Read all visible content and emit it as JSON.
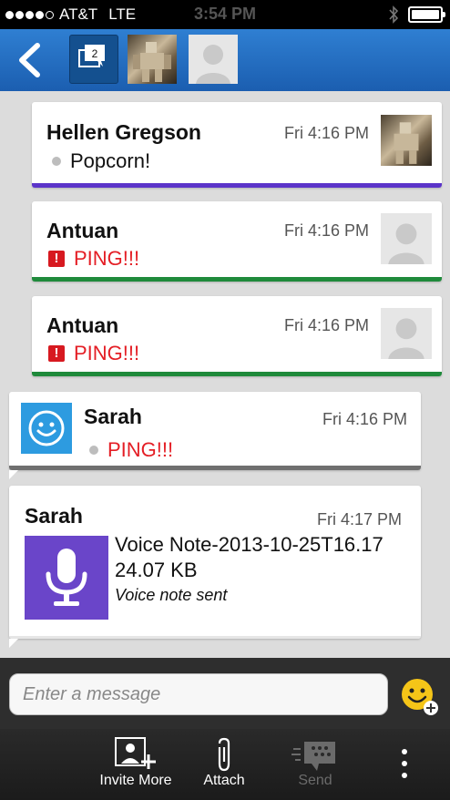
{
  "status_bar": {
    "carrier": "AT&T",
    "network": "LTE",
    "time": "3:54 PM"
  },
  "header": {
    "chats_badge": "2"
  },
  "messages": [
    {
      "name": "Hellen Gregson",
      "time": "Fri 4:16 PM",
      "text": "Popcorn!",
      "accent": "#5b34c9"
    },
    {
      "name": "Antuan",
      "time": "Fri 4:16 PM",
      "text": "PING!!!",
      "accent": "#1f8a3b"
    },
    {
      "name": "Antuan",
      "time": "Fri 4:16 PM",
      "text": "PING!!!",
      "accent": "#1f8a3b"
    },
    {
      "name": "Sarah",
      "time": "Fri 4:16 PM",
      "text": "PING!!!",
      "accent": "#6f6f6f"
    },
    {
      "name": "Sarah",
      "time": "Fri 4:17 PM",
      "file_name": "Voice Note-2013-10-25T16.17",
      "file_size": "24.07 KB",
      "status": "Voice note sent",
      "accent": "#6a45c9"
    }
  ],
  "input": {
    "placeholder": "Enter a message"
  },
  "toolbar": {
    "invite": "Invite More",
    "attach": "Attach",
    "send": "Send"
  },
  "colors": {
    "header_blue": "#1b5eb0",
    "ping_red": "#e41e25",
    "voice_purple": "#6a45c9"
  },
  "icons": [
    "back-chevron-icon",
    "chats-icon",
    "emoji-icon",
    "invite-icon",
    "attach-icon",
    "send-icon",
    "more-icon",
    "microphone-icon"
  ]
}
